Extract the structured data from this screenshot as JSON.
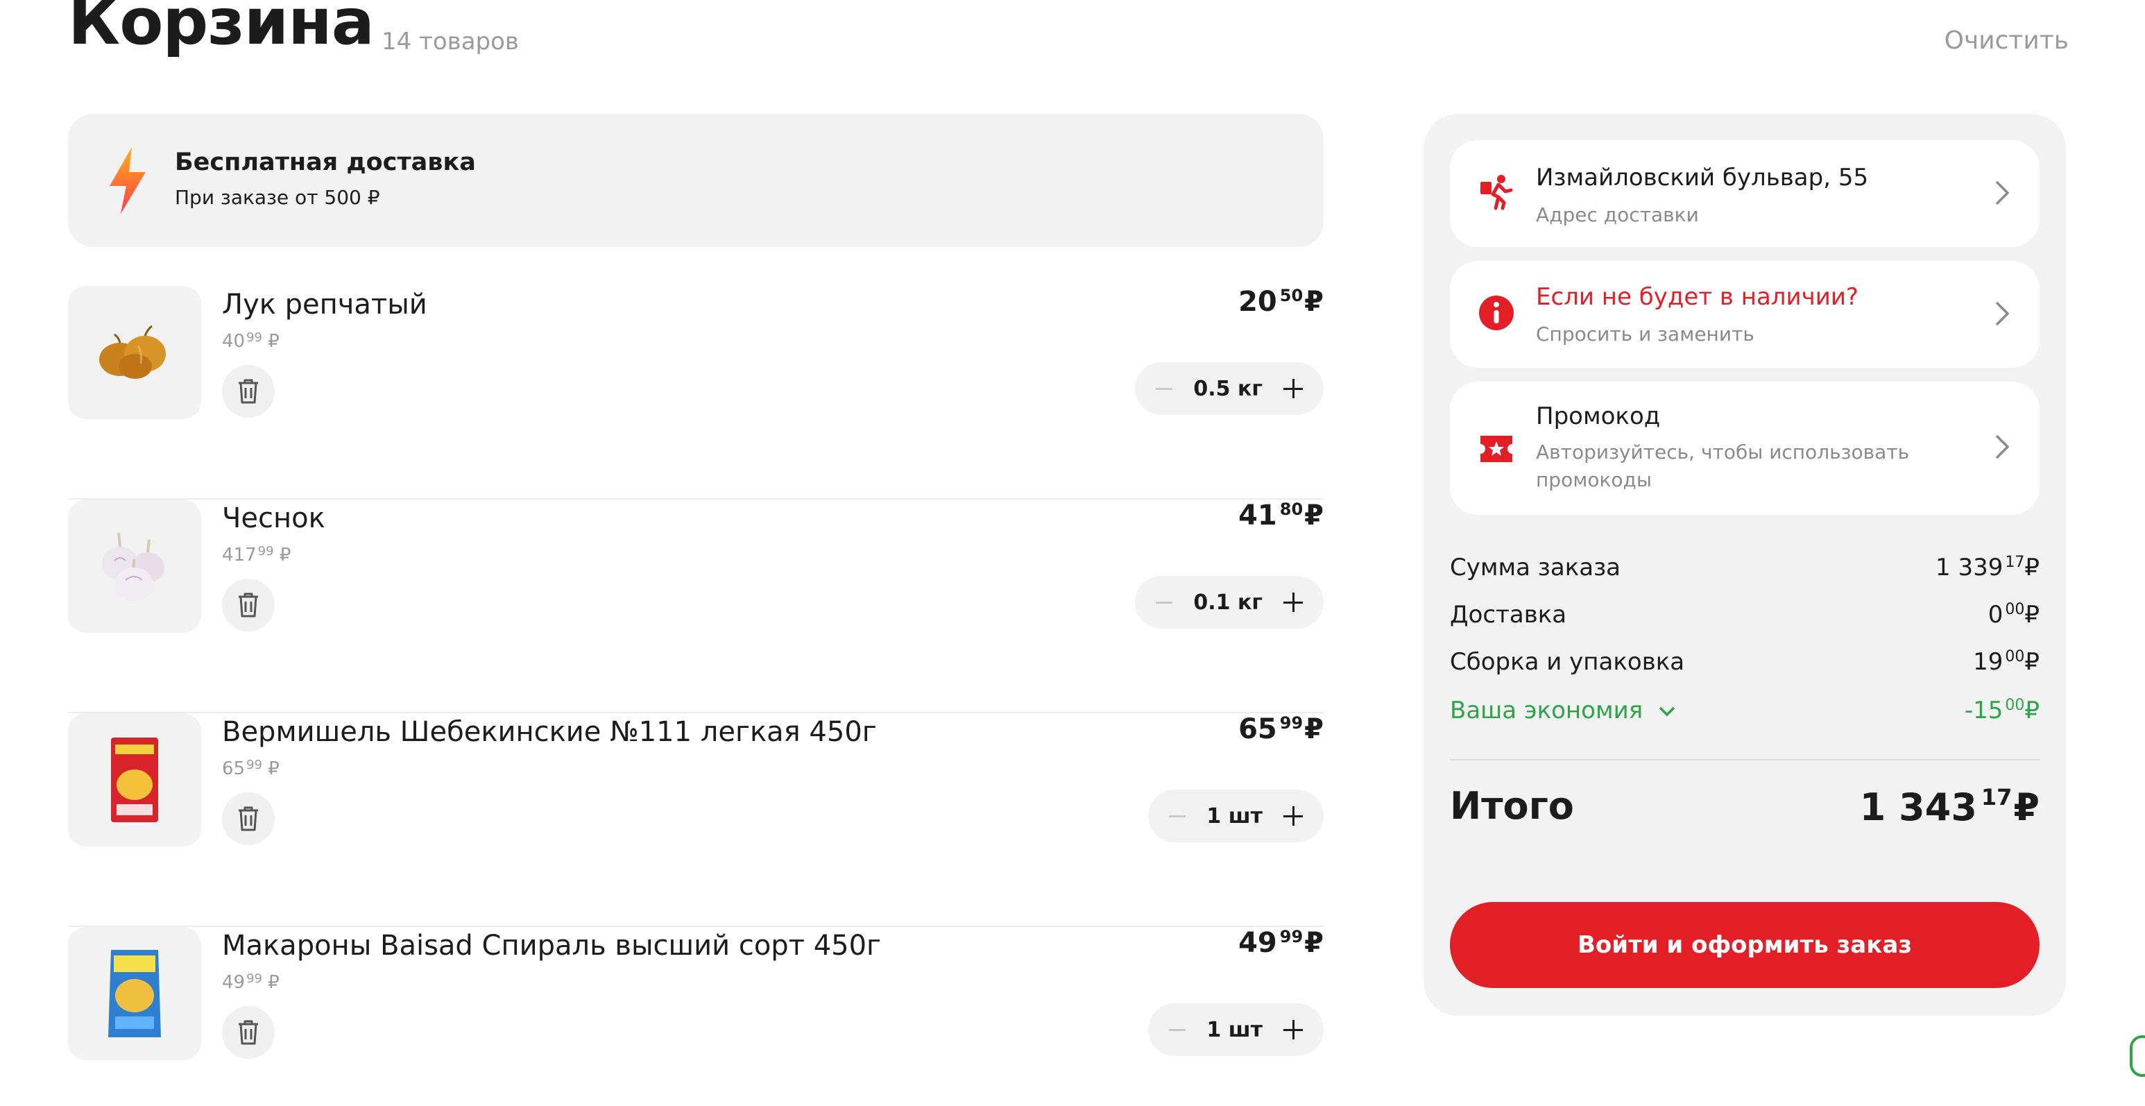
{
  "header": {
    "title": "Корзина",
    "count": "14 товаров",
    "clear": "Очистить"
  },
  "banner": {
    "title": "Бесплатная доставка",
    "subtitle": "При заказе от 500 ₽",
    "icon": "lightning-icon"
  },
  "items": [
    {
      "name": "Лук репчатый",
      "unit_main": "40",
      "unit_cents": "99",
      "unit_cur": "₽",
      "price_main": "20",
      "price_cents": "50",
      "price_cur": "₽",
      "qty": "0.5 кг",
      "image": "onion"
    },
    {
      "name": "Чеснок",
      "unit_main": "417",
      "unit_cents": "99",
      "unit_cur": "₽",
      "price_main": "41",
      "price_cents": "80",
      "price_cur": "₽",
      "qty": "0.1 кг",
      "image": "garlic"
    },
    {
      "name": "Вермишель Шебекинские №111 легкая 450г",
      "unit_main": "65",
      "unit_cents": "99",
      "unit_cur": "₽",
      "price_main": "65",
      "price_cents": "99",
      "price_cur": "₽",
      "qty": "1 шт",
      "image": "vermicelli-pack"
    },
    {
      "name": "Макароны Baisad Спираль высший сорт 450г",
      "unit_main": "49",
      "unit_cents": "99",
      "unit_cur": "₽",
      "price_main": "49",
      "price_cents": "99",
      "price_cur": "₽",
      "qty": "1 шт",
      "image": "pasta-pack"
    }
  ],
  "side": {
    "address": {
      "title": "Измайловский бульвар, 55",
      "subtitle": "Адрес доставки",
      "icon": "courier-icon"
    },
    "missing": {
      "title": "Если не будет в наличии?",
      "subtitle": "Спросить и заменить",
      "icon": "info-icon"
    },
    "promo": {
      "title": "Промокод",
      "subtitle_line1": "Авторизуйтесь, чтобы использовать",
      "subtitle_line2": "промокоды",
      "icon": "coupon-icon"
    },
    "summary": [
      {
        "label": "Сумма заказа",
        "main": "1 339",
        "cents": "17",
        "cur": "₽"
      },
      {
        "label": "Доставка",
        "main": "0",
        "cents": "00",
        "cur": "₽"
      },
      {
        "label": "Сборка и упаковка",
        "main": "19",
        "cents": "00",
        "cur": "₽"
      },
      {
        "label": "Ваша экономия",
        "main": "-15",
        "cents": "00",
        "cur": "₽"
      }
    ],
    "total": {
      "label": "Итого",
      "main": "1 343",
      "cents": "17",
      "cur": "₽"
    },
    "checkout": "Войти и оформить заказ"
  },
  "colors": {
    "accent_red": "#e21f26",
    "savings_green": "#2fa34a",
    "panel_bg": "#f2f2f2"
  }
}
